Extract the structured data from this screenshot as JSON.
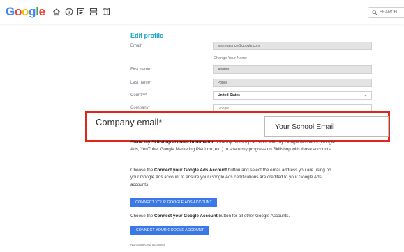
{
  "header": {
    "logo_letters": [
      {
        "char": "G",
        "color": "#4285f4"
      },
      {
        "char": "o",
        "color": "#ea4335"
      },
      {
        "char": "o",
        "color": "#fbbc05"
      },
      {
        "char": "g",
        "color": "#4285f4"
      },
      {
        "char": "l",
        "color": "#34a853"
      },
      {
        "char": "e",
        "color": "#ea4335"
      }
    ],
    "nav_icons": [
      "home-icon",
      "help-icon",
      "article-icon",
      "list-icon",
      "map-icon"
    ],
    "search_label": "SEARCH"
  },
  "form": {
    "title": "Edit profile",
    "email_label": "Email*",
    "email_value": "andreaponce@google.com",
    "change_name_caption": "Change Your Name",
    "first_name_label": "First name*",
    "first_name_value": "Andrea",
    "last_name_label": "Last name*",
    "last_name_value": "Ponce",
    "country_label": "Country*",
    "country_value": "United States",
    "company_label": "Company*",
    "company_value": "Google"
  },
  "callout": {
    "label": "Company email*",
    "field_value": "Your School Email"
  },
  "info": {
    "p1_lead": "Share my Skillshop account information.",
    "p1_rest": " Link my Skillshop account with my Google Accounts (Google Ads, YouTube, Google Marketing Platform, etc.) to share my progress on Skillshop with those accounts.",
    "p2_a": "Choose the ",
    "p2_bold": "Connect your Google Ads Account",
    "p2_b": " button and select the email address you are using on your Google Ads account to ensure your Google Ads certifications are credited to your Google Ads accounts.",
    "ads_button": "CONNECT YOUR GOOGLE ADS ACCOUNT",
    "p3_a": "Choose the ",
    "p3_bold": "Connect your Google Account",
    "p3_b": " button for all other Google Accounts.",
    "google_button": "CONNECT YOUR GOOGLE ACCOUNT",
    "no_accounts": "No connected accounts"
  },
  "colors": {
    "accent": "#1aa3c8",
    "button": "#3b78e7",
    "highlight": "#e1251b"
  }
}
